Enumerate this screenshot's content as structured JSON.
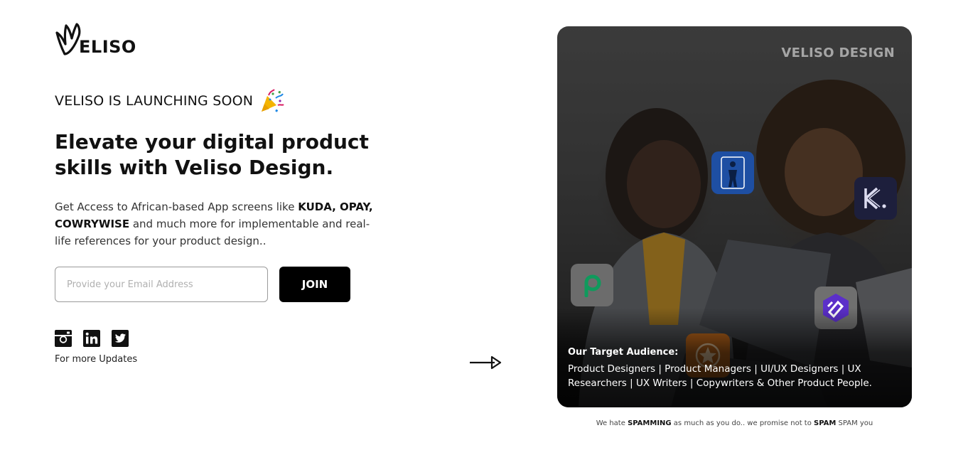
{
  "brand": {
    "name": "ELISO",
    "logo_icon": "veliso-v-logo"
  },
  "hero": {
    "launch_text": "VELISO IS LAUNCHING SOON",
    "launch_icon": "party-popper-icon",
    "headline": "Elevate your digital product skills with Veliso Design.",
    "desc_prefix": "Get Access to African-based App screens like ",
    "desc_bold": "KUDA, OPAY, COWRYWISE",
    "desc_suffix": " and much more for implementable and real-life references for your product design.."
  },
  "signup": {
    "email_placeholder": "Provide your Email Address",
    "email_value": "",
    "join_label": "JOIN"
  },
  "socials": {
    "items": [
      {
        "name": "instagram-icon"
      },
      {
        "name": "linkedin-icon"
      },
      {
        "name": "twitter-icon"
      }
    ],
    "caption": "For more Updates"
  },
  "card": {
    "brand_mark": "VELISO DESIGN",
    "audience_title": "Our Target Audience:",
    "audience_text": "Product Designers | Product Managers | UI/UX Designers | UX Researchers | UX Writers | Copywriters & Other Product People."
  },
  "spam_note": {
    "p1": "We hate ",
    "b1": "SPAMMING",
    "p2": " as much as you do.. we promise not to ",
    "b2": "SPAM",
    "p3": " SPAM you"
  },
  "colors": {
    "button_bg": "#000000",
    "button_text": "#ffffff",
    "input_border": "#9a9a9a",
    "tile_blue": "#1e4fa3",
    "tile_orange": "#b8641a"
  }
}
